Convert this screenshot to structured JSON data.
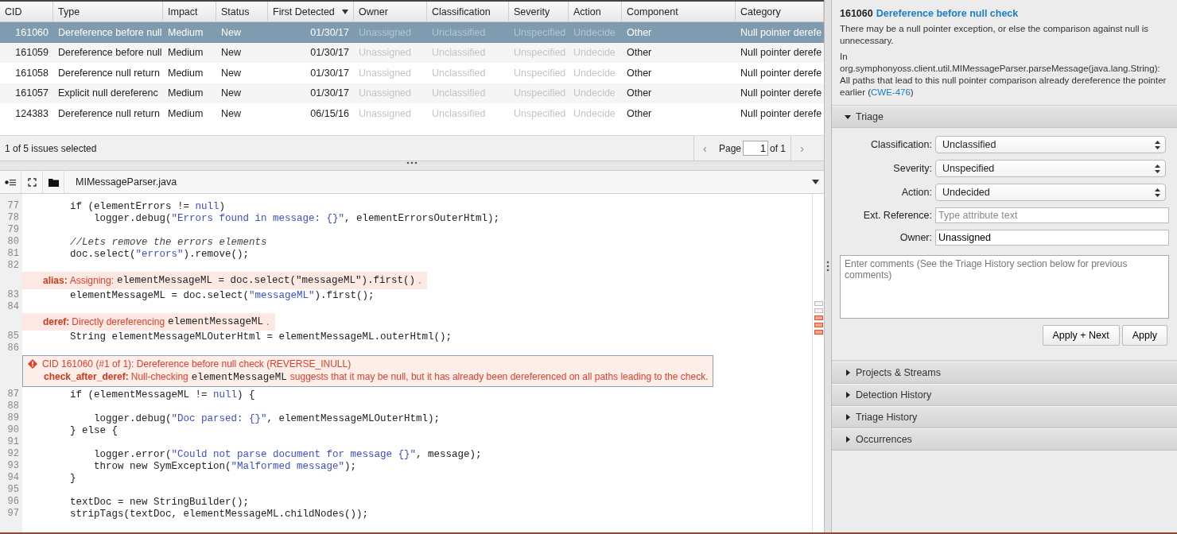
{
  "issues": {
    "columns": [
      {
        "label": "CID",
        "kind": "id",
        "sorted": false
      },
      {
        "label": "Type",
        "kind": "text",
        "sorted": false
      },
      {
        "label": "Impact",
        "kind": "text",
        "sorted": false
      },
      {
        "label": "Status",
        "kind": "text",
        "sorted": false
      },
      {
        "label": "First Detected",
        "kind": "date",
        "sorted": true
      },
      {
        "label": "Owner",
        "kind": "unset",
        "sorted": false
      },
      {
        "label": "Classification",
        "kind": "unset",
        "sorted": false
      },
      {
        "label": "Severity",
        "kind": "unset",
        "sorted": false
      },
      {
        "label": "Action",
        "kind": "unset",
        "sorted": false
      },
      {
        "label": "Component",
        "kind": "text",
        "sorted": false
      },
      {
        "label": "Category",
        "kind": "text",
        "sorted": false
      }
    ],
    "rows": [
      {
        "selected": true,
        "cells": [
          "161060",
          "Dereference before null",
          "Medium",
          "New",
          "01/30/17",
          "Unassigned",
          "Unclassified",
          "Unspecified",
          "Undecide",
          "Other",
          "Null pointer derefe"
        ]
      },
      {
        "selected": false,
        "cells": [
          "161059",
          "Dereference before null",
          "Medium",
          "New",
          "01/30/17",
          "Unassigned",
          "Unclassified",
          "Unspecified",
          "Undecide",
          "Other",
          "Null pointer derefe"
        ]
      },
      {
        "selected": false,
        "cells": [
          "161058",
          "Dereference null return",
          "Medium",
          "New",
          "01/30/17",
          "Unassigned",
          "Unclassified",
          "Unspecified",
          "Undecide",
          "Other",
          "Null pointer derefe"
        ]
      },
      {
        "selected": false,
        "cells": [
          "161057",
          "Explicit null dereferenc",
          "Medium",
          "New",
          "01/30/17",
          "Unassigned",
          "Unclassified",
          "Unspecified",
          "Undecide",
          "Other",
          "Null pointer derefe"
        ]
      },
      {
        "selected": false,
        "cells": [
          "124383",
          "Dereference null return",
          "Medium",
          "New",
          "06/15/16",
          "Unassigned",
          "Unclassified",
          "Unspecified",
          "Undecide",
          "Other",
          "Null pointer derefe"
        ]
      }
    ],
    "status": "1 of 5 issues selected",
    "pager": {
      "prev": "‹",
      "label": "Page",
      "page": "1",
      "total": "of 1",
      "next": "›"
    }
  },
  "editor": {
    "filename": "MIMessageParser.java",
    "lines": [
      {
        "kind": "code",
        "number": "77",
        "code": [
          {
            "kind": "plain",
            "text": "        if (elementErrors != "
          },
          {
            "kind": "keyword",
            "text": "null"
          },
          {
            "kind": "plain",
            "text": ")"
          }
        ]
      },
      {
        "kind": "code",
        "number": "78",
        "code": [
          {
            "kind": "plain",
            "text": "            logger.debug("
          },
          {
            "kind": "string",
            "text": "\"Errors found in message: {}\""
          },
          {
            "kind": "plain",
            "text": ", elementErrorsOuterHtml);"
          }
        ]
      },
      {
        "kind": "code",
        "number": "79"
      },
      {
        "kind": "code",
        "number": "80",
        "code": [
          {
            "kind": "comment",
            "text": "        //Lets remove the errors elements"
          }
        ]
      },
      {
        "kind": "code",
        "number": "81",
        "code": [
          {
            "kind": "plain",
            "text": "        doc.select("
          },
          {
            "kind": "string",
            "text": "\"errors\""
          },
          {
            "kind": "plain",
            "text": ").remove();"
          }
        ]
      },
      {
        "kind": "code",
        "number": "82"
      },
      {
        "kind": "event",
        "tag": "alias:",
        "text": "Assigning:",
        "code": "elementMessageML = doc.select(\"messageML\").first()",
        "tail": "."
      },
      {
        "kind": "code",
        "number": "83",
        "code": [
          {
            "kind": "plain",
            "text": "        elementMessageML = doc.select("
          },
          {
            "kind": "string",
            "text": "\"messageML\""
          },
          {
            "kind": "plain",
            "text": ").first();"
          }
        ]
      },
      {
        "kind": "code",
        "number": "84"
      },
      {
        "kind": "event",
        "tag": "deref:",
        "text": "Directly dereferencing",
        "code": "elementMessageML",
        "tail": "."
      },
      {
        "kind": "code",
        "number": "85",
        "code": [
          {
            "kind": "plain",
            "text": "        String elementMessageMLOuterHtml = elementMessageML.outerHtml();"
          }
        ]
      },
      {
        "kind": "code",
        "number": "86"
      },
      {
        "kind": "issue",
        "title": "CID 161060 (#1 of 1): Dereference before null check (REVERSE_INULL)",
        "tag": "check_after_deref:",
        "text": "Null-checking",
        "code": "elementMessageML",
        "tail": "suggests that it may be null, but it has already been dereferenced on all paths leading to the check."
      },
      {
        "kind": "code",
        "number": "87",
        "code": [
          {
            "kind": "plain",
            "text": "        if (elementMessageML != "
          },
          {
            "kind": "keyword",
            "text": "null"
          },
          {
            "kind": "plain",
            "text": ") {"
          }
        ]
      },
      {
        "kind": "code",
        "number": "88"
      },
      {
        "kind": "code",
        "number": "89",
        "code": [
          {
            "kind": "plain",
            "text": "            logger.debug("
          },
          {
            "kind": "string",
            "text": "\"Doc parsed: {}\""
          },
          {
            "kind": "plain",
            "text": ", elementMessageMLOuterHtml);"
          }
        ]
      },
      {
        "kind": "code",
        "number": "90",
        "code": [
          {
            "kind": "plain",
            "text": "        } else {"
          }
        ]
      },
      {
        "kind": "code",
        "number": "91"
      },
      {
        "kind": "code",
        "number": "92",
        "code": [
          {
            "kind": "plain",
            "text": "            logger.error("
          },
          {
            "kind": "string",
            "text": "\"Could not parse document for message {}\""
          },
          {
            "kind": "plain",
            "text": ", message);"
          }
        ]
      },
      {
        "kind": "code",
        "number": "93",
        "code": [
          {
            "kind": "plain",
            "text": "            throw new SymException("
          },
          {
            "kind": "string",
            "text": "\"Malformed message\""
          },
          {
            "kind": "plain",
            "text": ");"
          }
        ]
      },
      {
        "kind": "code",
        "number": "94",
        "code": [
          {
            "kind": "plain",
            "text": "        }"
          }
        ]
      },
      {
        "kind": "code",
        "number": "95"
      },
      {
        "kind": "code",
        "number": "96",
        "code": [
          {
            "kind": "plain",
            "text": "        textDoc = new StringBuilder();"
          }
        ]
      },
      {
        "kind": "code",
        "number": "97",
        "code": [
          {
            "kind": "plain",
            "text": "        stripTags(textDoc, elementMessageML.childNodes());"
          }
        ]
      }
    ]
  },
  "details": {
    "cid": "161060",
    "title": "Dereference before null check",
    "summary": "There may be a null pointer exception, or else the comparison against null is unnecessary.",
    "explanation": {
      "text": "In org.symphonyoss.client.util.MIMessageParser.parseMessage(java.lang.String): All paths that lead to this null pointer comparison already dereference the pointer earlier (",
      "link": "CWE-476",
      "tail": ")"
    },
    "sections": [
      {
        "label": "Triage",
        "expanded": true
      },
      {
        "label": "Projects & Streams",
        "expanded": false
      },
      {
        "label": "Detection History",
        "expanded": false
      },
      {
        "label": "Triage History",
        "expanded": false
      },
      {
        "label": "Occurrences",
        "expanded": false
      }
    ],
    "triage": {
      "fields": [
        {
          "label": "Classification:",
          "kind": "select",
          "value": "Unclassified"
        },
        {
          "label": "Severity:",
          "kind": "select",
          "value": "Unspecified"
        },
        {
          "label": "Action:",
          "kind": "select",
          "value": "Undecided"
        },
        {
          "label": "Ext. Reference:",
          "kind": "text",
          "placeholder": "Type attribute text"
        },
        {
          "label": "Owner:",
          "kind": "text",
          "value": "Unassigned"
        }
      ],
      "comments_placeholder": "Enter comments (See the Triage History section below for previous comments)",
      "buttons": [
        "Apply + Next",
        "Apply"
      ]
    }
  }
}
